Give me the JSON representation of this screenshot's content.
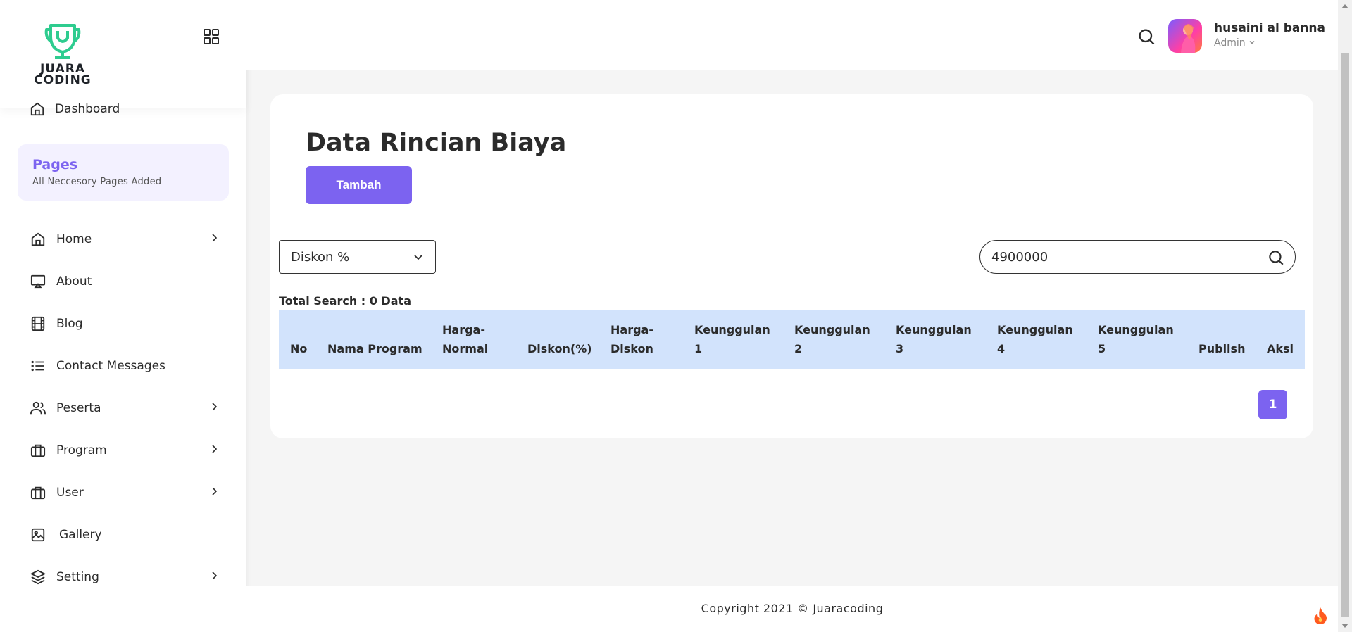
{
  "sidebar": {
    "logo": {
      "line1": "JUARA",
      "line2": "CODING",
      "color": "#2ecc8f"
    },
    "dashboard": "Dashboard",
    "pages_box": {
      "title": "Pages",
      "subtitle": "All Neccesory Pages Added"
    },
    "items": [
      {
        "label": "Home",
        "icon": "home-icon",
        "has_chevron": true
      },
      {
        "label": "About",
        "icon": "monitor-icon",
        "has_chevron": false
      },
      {
        "label": "Blog",
        "icon": "film-icon",
        "has_chevron": false
      },
      {
        "label": "Contact Messages",
        "icon": "list-icon",
        "has_chevron": false
      },
      {
        "label": "Peserta",
        "icon": "users-icon",
        "has_chevron": true
      },
      {
        "label": "Program",
        "icon": "briefcase-icon",
        "has_chevron": true
      },
      {
        "label": "User",
        "icon": "briefcase-icon",
        "has_chevron": true
      },
      {
        "label": "Gallery",
        "icon": "image-icon",
        "has_chevron": false
      },
      {
        "label": "Setting",
        "icon": "layers-icon",
        "has_chevron": true
      }
    ]
  },
  "header": {
    "user_name": "husaini al banna",
    "user_role": "Admin"
  },
  "main": {
    "title": "Data Rincian Biaya",
    "add_button": "Tambah",
    "filter_select": "Diskon %",
    "search_value": "4900000",
    "total_search": "Total Search : 0 Data",
    "columns": [
      "No",
      "Nama Program",
      "Harga-\nNormal",
      "Diskon(%)",
      "Harga-\nDiskon",
      "Keunggulan\n1",
      "Keunggulan\n2",
      "Keunggulan\n3",
      "Keunggulan\n4",
      "Keunggulan\n5",
      "Publish",
      "Aksi"
    ],
    "pagination": [
      "1"
    ]
  },
  "footer": {
    "copyright": "Copyright 2021 © Juaracoding"
  },
  "colors": {
    "accent": "#7c63f0",
    "table_header": "#d2e3fc",
    "pages_bg": "#f3f1ff"
  }
}
